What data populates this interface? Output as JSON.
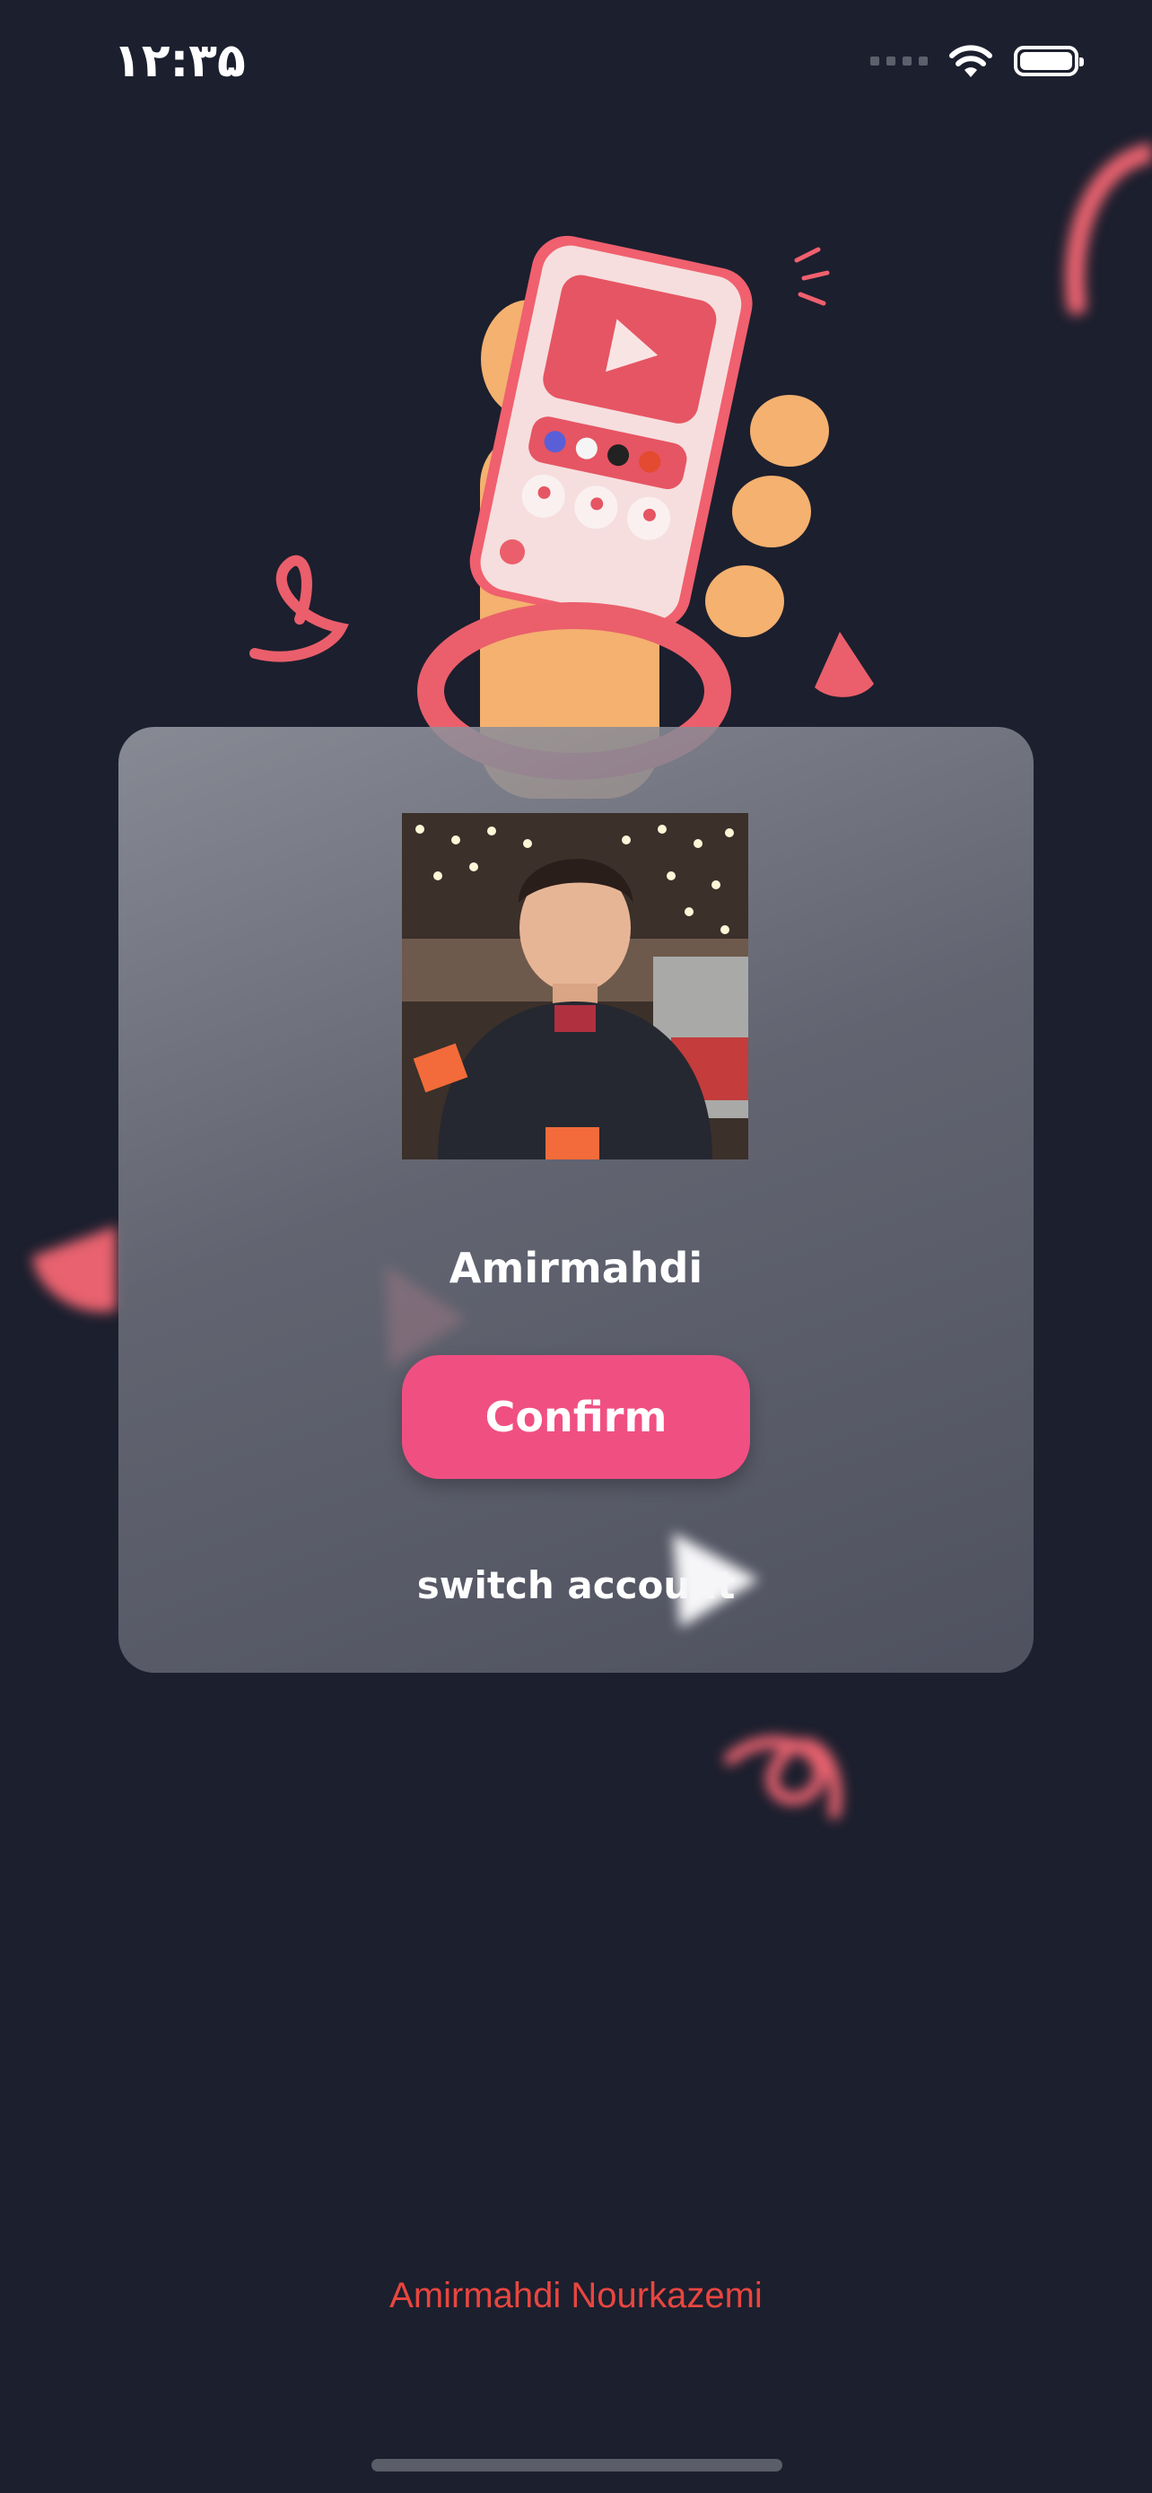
{
  "status_bar": {
    "time": "۱۲:۳۵"
  },
  "profile": {
    "name": "Amirmahdi"
  },
  "actions": {
    "confirm_label": "Confirm",
    "switch_label": "switch account"
  },
  "footer": {
    "credit": "Amirmahdi Nourkazemi"
  },
  "colors": {
    "background": "#1c1f2e",
    "accent": "#f04f82",
    "credit": "#e8463f"
  },
  "icons": [
    "wifi-icon",
    "battery-icon",
    "signal-icon",
    "play-icon"
  ]
}
